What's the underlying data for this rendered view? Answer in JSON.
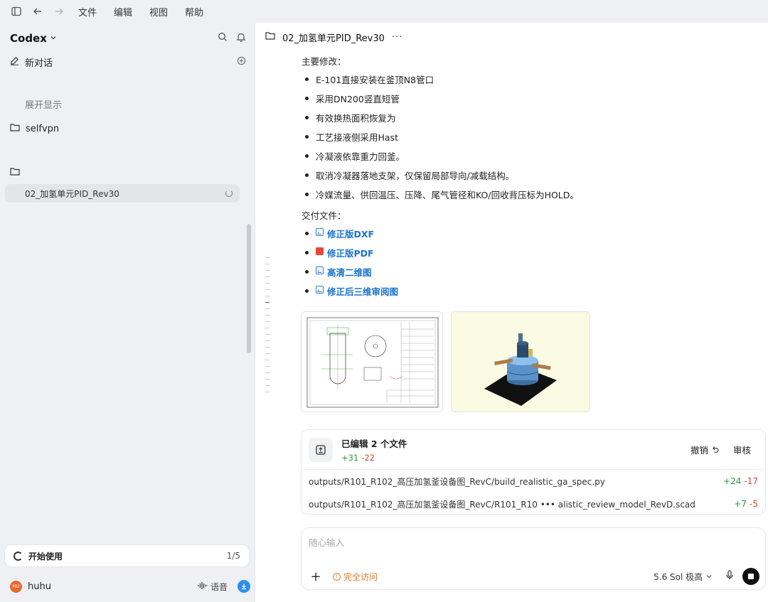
{
  "menubar": {
    "items": [
      "文件",
      "编辑",
      "视图",
      "帮助"
    ]
  },
  "sidebar": {
    "brand": "Codex",
    "new_chat": "新对话",
    "expand": "展开显示",
    "project_selfvpn": "selfvpn",
    "active_thread": "02_加氢单元PID_Rev30",
    "get_started": "开始使用",
    "get_started_count": "1/5",
    "user": "huhu",
    "avatar_initials": "HU",
    "voice": "语音"
  },
  "main": {
    "title": "02_加氢单元PID_Rev30",
    "changes_label": "主要修改：",
    "changes": [
      "E-101直接安装在釜顶N8管口",
      "采用DN200竖直短管",
      "有效换热面积恢复为",
      "工艺接液侧采用Hast",
      "冷凝液依靠重力回釜。",
      "取消冷凝器落地支架，仅保留局部导向/减载结构。",
      "冷媒流量、供回温压、压降、尾气管径和KO/回收背压标为HOLD。"
    ],
    "deliverables_label": "交付文件：",
    "files": [
      {
        "label": "修正版DXF",
        "type": "image"
      },
      {
        "label": "修正版PDF",
        "type": "pdf"
      },
      {
        "label": "高清二维图",
        "type": "image"
      },
      {
        "label": "修正后三维审阅图",
        "type": "image"
      }
    ],
    "edit": {
      "title": "已编辑 2 个文件",
      "added": "+31",
      "removed": "-22",
      "undo": "撤销",
      "review": "审核",
      "rows": [
        {
          "path": "outputs/R101_R102_高压加氢釜设备图_RevC/build_realistic_ga_spec.py",
          "added": "+24",
          "removed": "-17"
        },
        {
          "path": "outputs/R101_R102_高压加氢釜设备图_RevC/R101_R10 ••• alistic_review_model_RevD.scad",
          "added": "+7",
          "removed": "-5"
        }
      ]
    },
    "composer": {
      "placeholder": "随心输入",
      "access": "完全访问",
      "model": "5.6 Sol 极高"
    }
  },
  "colors": {
    "accent": "#1a73c9",
    "add": "#2a9a3a",
    "remove": "#d6443a",
    "access": "#e0782b"
  }
}
